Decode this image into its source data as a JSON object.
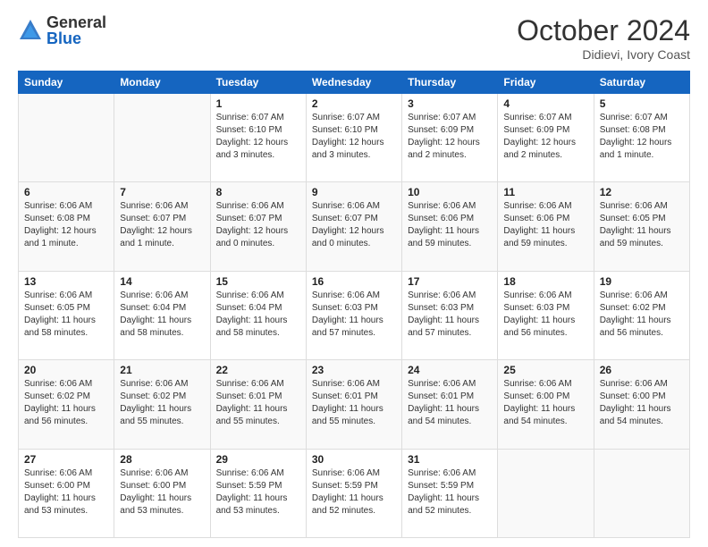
{
  "logo": {
    "general": "General",
    "blue": "Blue"
  },
  "header": {
    "month": "October 2024",
    "location": "Didievi, Ivory Coast"
  },
  "weekdays": [
    "Sunday",
    "Monday",
    "Tuesday",
    "Wednesday",
    "Thursday",
    "Friday",
    "Saturday"
  ],
  "weeks": [
    [
      {
        "day": "",
        "empty": true
      },
      {
        "day": "",
        "empty": true
      },
      {
        "day": "1",
        "info": "Sunrise: 6:07 AM\nSunset: 6:10 PM\nDaylight: 12 hours\nand 3 minutes."
      },
      {
        "day": "2",
        "info": "Sunrise: 6:07 AM\nSunset: 6:10 PM\nDaylight: 12 hours\nand 3 minutes."
      },
      {
        "day": "3",
        "info": "Sunrise: 6:07 AM\nSunset: 6:09 PM\nDaylight: 12 hours\nand 2 minutes."
      },
      {
        "day": "4",
        "info": "Sunrise: 6:07 AM\nSunset: 6:09 PM\nDaylight: 12 hours\nand 2 minutes."
      },
      {
        "day": "5",
        "info": "Sunrise: 6:07 AM\nSunset: 6:08 PM\nDaylight: 12 hours\nand 1 minute."
      }
    ],
    [
      {
        "day": "6",
        "info": "Sunrise: 6:06 AM\nSunset: 6:08 PM\nDaylight: 12 hours\nand 1 minute."
      },
      {
        "day": "7",
        "info": "Sunrise: 6:06 AM\nSunset: 6:07 PM\nDaylight: 12 hours\nand 1 minute."
      },
      {
        "day": "8",
        "info": "Sunrise: 6:06 AM\nSunset: 6:07 PM\nDaylight: 12 hours\nand 0 minutes."
      },
      {
        "day": "9",
        "info": "Sunrise: 6:06 AM\nSunset: 6:07 PM\nDaylight: 12 hours\nand 0 minutes."
      },
      {
        "day": "10",
        "info": "Sunrise: 6:06 AM\nSunset: 6:06 PM\nDaylight: 11 hours\nand 59 minutes."
      },
      {
        "day": "11",
        "info": "Sunrise: 6:06 AM\nSunset: 6:06 PM\nDaylight: 11 hours\nand 59 minutes."
      },
      {
        "day": "12",
        "info": "Sunrise: 6:06 AM\nSunset: 6:05 PM\nDaylight: 11 hours\nand 59 minutes."
      }
    ],
    [
      {
        "day": "13",
        "info": "Sunrise: 6:06 AM\nSunset: 6:05 PM\nDaylight: 11 hours\nand 58 minutes."
      },
      {
        "day": "14",
        "info": "Sunrise: 6:06 AM\nSunset: 6:04 PM\nDaylight: 11 hours\nand 58 minutes."
      },
      {
        "day": "15",
        "info": "Sunrise: 6:06 AM\nSunset: 6:04 PM\nDaylight: 11 hours\nand 58 minutes."
      },
      {
        "day": "16",
        "info": "Sunrise: 6:06 AM\nSunset: 6:03 PM\nDaylight: 11 hours\nand 57 minutes."
      },
      {
        "day": "17",
        "info": "Sunrise: 6:06 AM\nSunset: 6:03 PM\nDaylight: 11 hours\nand 57 minutes."
      },
      {
        "day": "18",
        "info": "Sunrise: 6:06 AM\nSunset: 6:03 PM\nDaylight: 11 hours\nand 56 minutes."
      },
      {
        "day": "19",
        "info": "Sunrise: 6:06 AM\nSunset: 6:02 PM\nDaylight: 11 hours\nand 56 minutes."
      }
    ],
    [
      {
        "day": "20",
        "info": "Sunrise: 6:06 AM\nSunset: 6:02 PM\nDaylight: 11 hours\nand 56 minutes."
      },
      {
        "day": "21",
        "info": "Sunrise: 6:06 AM\nSunset: 6:02 PM\nDaylight: 11 hours\nand 55 minutes."
      },
      {
        "day": "22",
        "info": "Sunrise: 6:06 AM\nSunset: 6:01 PM\nDaylight: 11 hours\nand 55 minutes."
      },
      {
        "day": "23",
        "info": "Sunrise: 6:06 AM\nSunset: 6:01 PM\nDaylight: 11 hours\nand 55 minutes."
      },
      {
        "day": "24",
        "info": "Sunrise: 6:06 AM\nSunset: 6:01 PM\nDaylight: 11 hours\nand 54 minutes."
      },
      {
        "day": "25",
        "info": "Sunrise: 6:06 AM\nSunset: 6:00 PM\nDaylight: 11 hours\nand 54 minutes."
      },
      {
        "day": "26",
        "info": "Sunrise: 6:06 AM\nSunset: 6:00 PM\nDaylight: 11 hours\nand 54 minutes."
      }
    ],
    [
      {
        "day": "27",
        "info": "Sunrise: 6:06 AM\nSunset: 6:00 PM\nDaylight: 11 hours\nand 53 minutes."
      },
      {
        "day": "28",
        "info": "Sunrise: 6:06 AM\nSunset: 6:00 PM\nDaylight: 11 hours\nand 53 minutes."
      },
      {
        "day": "29",
        "info": "Sunrise: 6:06 AM\nSunset: 5:59 PM\nDaylight: 11 hours\nand 53 minutes."
      },
      {
        "day": "30",
        "info": "Sunrise: 6:06 AM\nSunset: 5:59 PM\nDaylight: 11 hours\nand 52 minutes."
      },
      {
        "day": "31",
        "info": "Sunrise: 6:06 AM\nSunset: 5:59 PM\nDaylight: 11 hours\nand 52 minutes."
      },
      {
        "day": "",
        "empty": true
      },
      {
        "day": "",
        "empty": true
      }
    ]
  ]
}
